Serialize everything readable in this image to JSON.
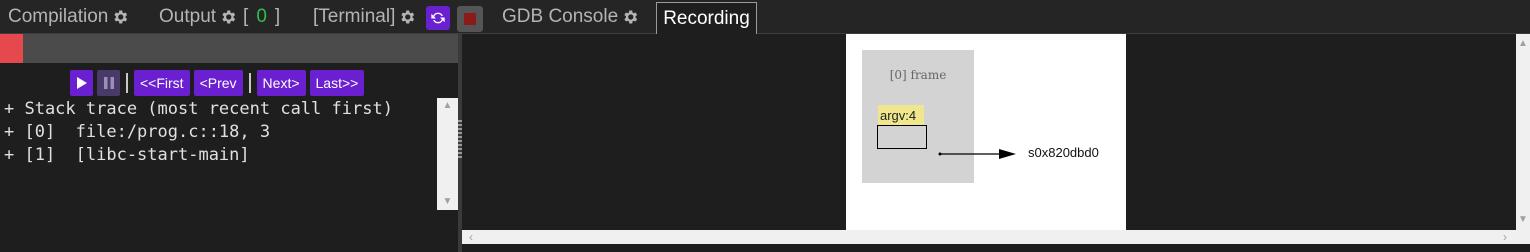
{
  "tabs": {
    "compilation": "Compilation",
    "output": "Output",
    "output_bracket_open": "[",
    "output_count": "0",
    "output_bracket_close": "]",
    "terminal": "[Terminal]",
    "gdb_console": "GDB Console",
    "recording": "Recording"
  },
  "toolbar": {
    "refresh_icon": "refresh-icon",
    "stop_icon": "stop-icon"
  },
  "player": {
    "progress": 0.05,
    "progress_color": "#e5484d",
    "play_icon": "play-icon",
    "pause_icon": "pause-icon",
    "first": "<<First",
    "prev": "<Prev",
    "next": "Next>",
    "last": "Last>>"
  },
  "stack_trace": {
    "text": "+ Stack trace (most recent call first)\n+ [0]  file:/prog.c::18, 3\n+ [1]  [libc-start-main]"
  },
  "recording": {
    "frame_label": "[0] frame",
    "var_label": "argv:4",
    "pointer_value": "s0x820dbd0"
  },
  "colors": {
    "accent": "#6a1fd0",
    "stop": "#8b1a1a",
    "output_count": "#2fbf4f",
    "var_highlight": "#f0e68c"
  }
}
